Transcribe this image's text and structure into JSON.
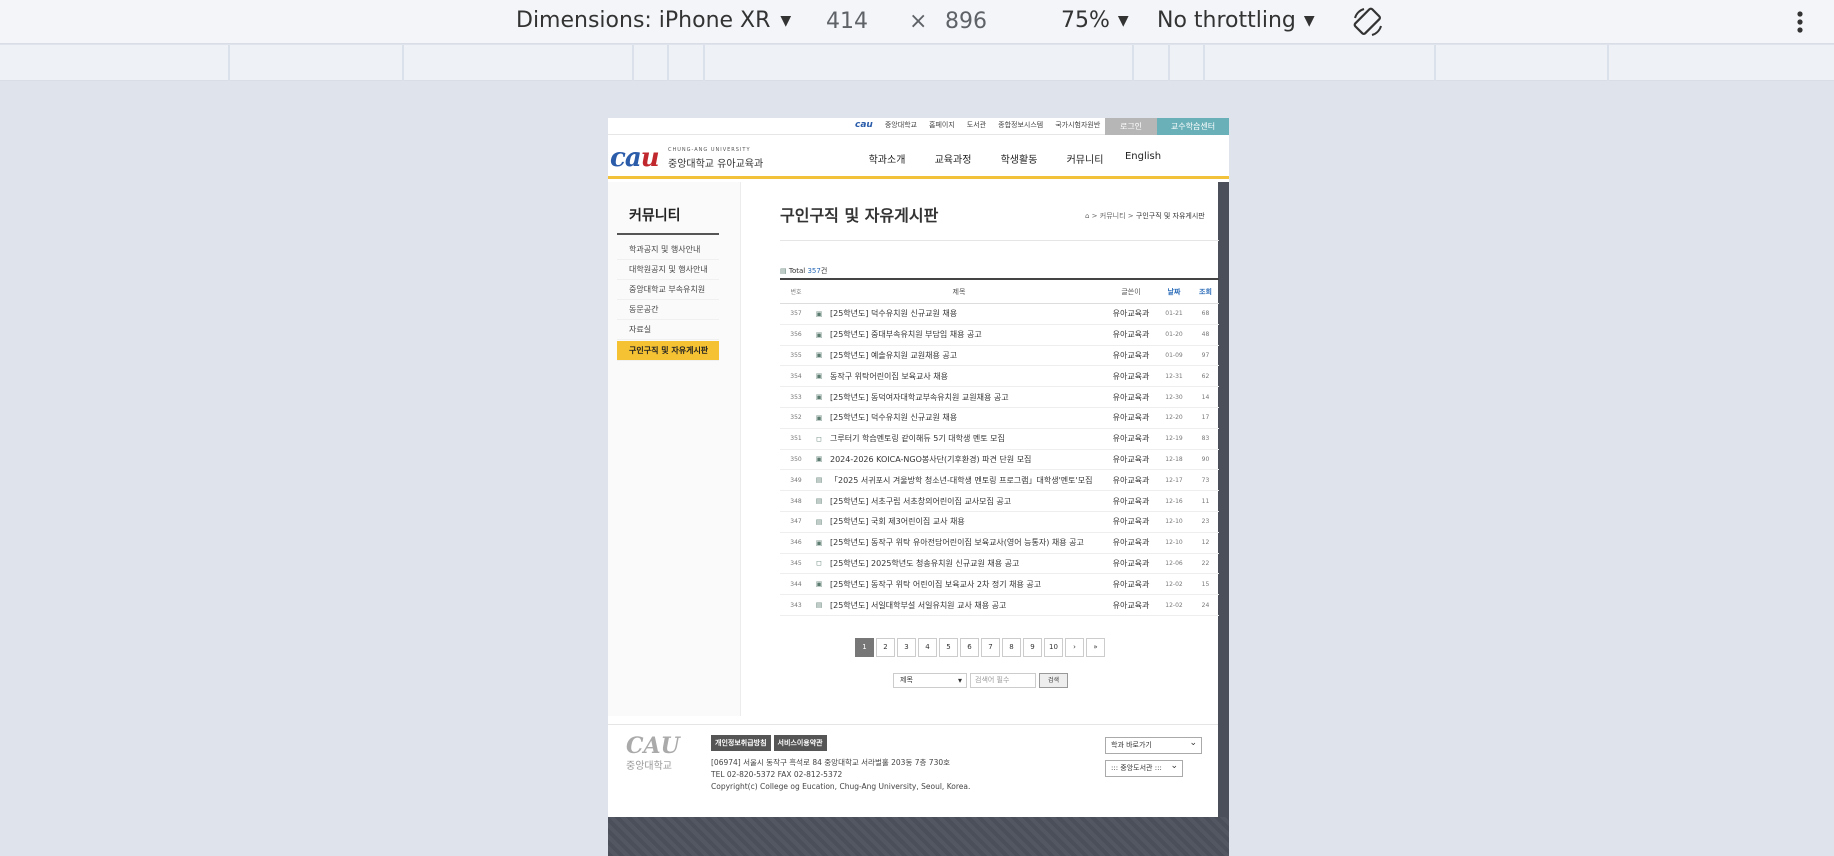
{
  "devtools": {
    "device": "Dimensions: iPhone XR",
    "width": "414",
    "times": "×",
    "height": "896",
    "zoom": "75%",
    "throttle": "No throttling"
  },
  "site": {
    "top_links": [
      "중앙대학교",
      "홈페이지",
      "도서관",
      "종합정보시스템",
      "국가시험자원반"
    ],
    "login": "로그인",
    "center": "교수학습센터",
    "logo": "CAU",
    "logo_en": "CHUNG-ANG UNIVERSITY",
    "logo_ko": "중앙대학교 유아교육과",
    "gnb": [
      "학과소개",
      "교육과정",
      "학생활동",
      "커뮤니티",
      "English"
    ]
  },
  "lnb": {
    "title": "커뮤니티",
    "items": [
      "학과공지 및 행사안내",
      "대학원공지 및 행사안내",
      "중앙대학교 부속유치원",
      "동문공간",
      "자료실",
      "구인구직 및 자유게시판"
    ]
  },
  "board": {
    "title": "구인구직 및 자유게시판",
    "breadcrumb": [
      "⌂",
      "커뮤니티",
      "구인구직 및 자유게시판"
    ],
    "total_label": "Total",
    "total_count": "357",
    "total_unit": "건",
    "headers": [
      "번호",
      "제목",
      "글쓴이",
      "날짜",
      "조회"
    ],
    "rows": [
      {
        "no": "357",
        "title": "[25학년도] 덕수유치원 신규교원 채용",
        "author": "유아교육과",
        "date": "01-21",
        "views": "68"
      },
      {
        "no": "356",
        "title": "[25학년도] 중대부속유치원 부담임 채용 공고",
        "author": "유아교육과",
        "date": "01-20",
        "views": "48"
      },
      {
        "no": "355",
        "title": "[25학년도] 예솔유치원 교원채용 공고",
        "author": "유아교육과",
        "date": "01-09",
        "views": "97"
      },
      {
        "no": "354",
        "title": "동작구 위탁어린이집 보육교사 채용",
        "author": "유아교육과",
        "date": "12-31",
        "views": "62"
      },
      {
        "no": "353",
        "title": "[25학년도] 동덕여자대학교부속유치원 교원채용 공고",
        "author": "유아교육과",
        "date": "12-30",
        "views": "14"
      },
      {
        "no": "352",
        "title": "[25학년도] 덕수유치원 신규교원 채용",
        "author": "유아교육과",
        "date": "12-20",
        "views": "17"
      },
      {
        "no": "351",
        "title": "그루터기 학습멘토링 같이해듀 5기 대학생 멘토 모집",
        "author": "유아교육과",
        "date": "12-19",
        "views": "83"
      },
      {
        "no": "350",
        "title": "2024-2026 KOICA-NGO봉사단(기후환경) 파견 단원 모집",
        "author": "유아교육과",
        "date": "12-18",
        "views": "90"
      },
      {
        "no": "349",
        "title": "「2025 서귀포시 겨울방학 청소년-대학생 멘토링 프로그램」대학생'멘토'모집",
        "author": "유아교육과",
        "date": "12-17",
        "views": "73"
      },
      {
        "no": "348",
        "title": "[25학년도] 서초구립 서초창의어린이집 교사모집 공고",
        "author": "유아교육과",
        "date": "12-16",
        "views": "11"
      },
      {
        "no": "347",
        "title": "[25학년도] 국회 제3어린이집 교사 채용",
        "author": "유아교육과",
        "date": "12-10",
        "views": "23"
      },
      {
        "no": "346",
        "title": "[25학년도] 동작구 위탁 유아전담어린이집 보육교사(영어 능통자) 채용 공고",
        "author": "유아교육과",
        "date": "12-10",
        "views": "12"
      },
      {
        "no": "345",
        "title": "[25학년도] 2025학년도 청송유치원 신규교원 채용 공고",
        "author": "유아교육과",
        "date": "12-06",
        "views": "22"
      },
      {
        "no": "344",
        "title": "[25학년도] 동작구 위탁 어린이집 보육교사 2차 정기 채용 공고",
        "author": "유아교육과",
        "date": "12-02",
        "views": "15"
      },
      {
        "no": "343",
        "title": "[25학년도] 서일대학부설 서일유치원 교사 채용 공고",
        "author": "유아교육과",
        "date": "12-02",
        "views": "24"
      }
    ],
    "pages": [
      "1",
      "2",
      "3",
      "4",
      "5",
      "6",
      "7",
      "8",
      "9",
      "10",
      "›",
      "»"
    ],
    "search_field": "제목",
    "search_placeholder": "검색어 필수",
    "search_button": "검색"
  },
  "footer": {
    "logo": "CAU",
    "logo_sub": "중앙대학교",
    "privacy": "개인정보취급방침",
    "terms": "서비스이용약관",
    "address": "[06974] 서울시 동작구 흑석로 84 중앙대학교 서라벌홀 203동 7층 730호",
    "tel": "TEL 02-820-5372 FAX 02-812-5372",
    "copyright": "Copyright(c) College og Eucation, Chug-Ang University, Seoul, Korea.",
    "dept_select": "학과 바로가기",
    "lib_select": "::: 중앙도서관 :::"
  }
}
